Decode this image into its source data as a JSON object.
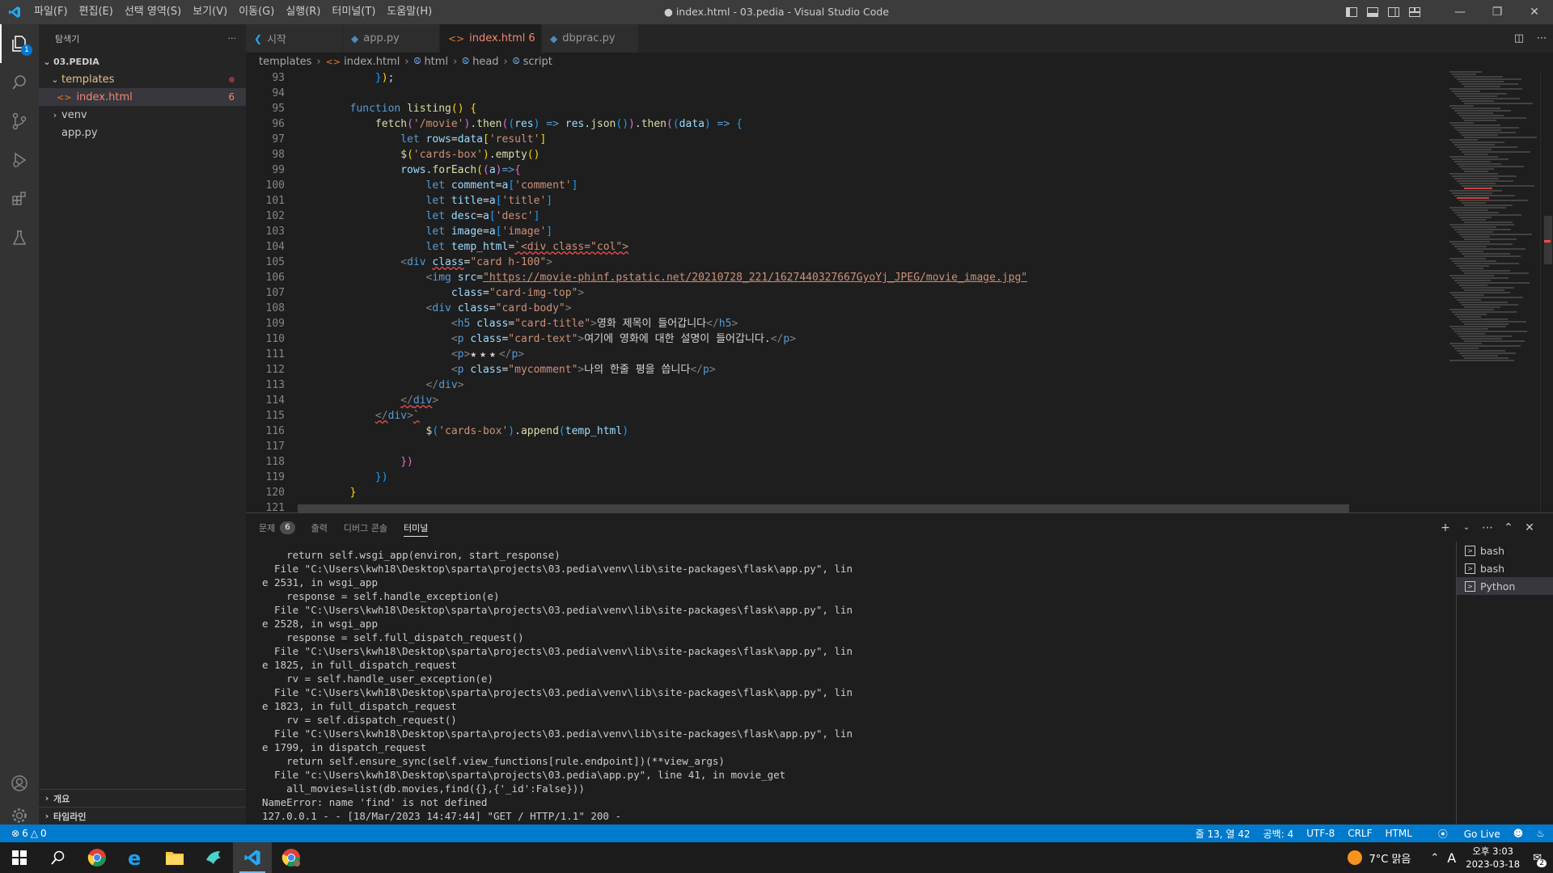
{
  "window": {
    "title": "● index.html - 03.pedia - Visual Studio Code"
  },
  "menu": [
    "파일(F)",
    "편집(E)",
    "선택 영역(S)",
    "보기(V)",
    "이동(G)",
    "실행(R)",
    "터미널(T)",
    "도움말(H)"
  ],
  "activity": {
    "explorer_badge": "1"
  },
  "sidebar": {
    "title": "탐색기",
    "more": "···",
    "root": "03.PEDIA",
    "templates": "templates",
    "index_file": "index.html",
    "index_count": "6",
    "venv": "venv",
    "app": "app.py",
    "outline": "개요",
    "timeline": "타임라인"
  },
  "tabs": [
    {
      "label": "시작",
      "icon": "vscode-icon"
    },
    {
      "label": "app.py",
      "icon": "python-icon"
    },
    {
      "label": "index.html",
      "count": "6",
      "icon": "html-icon"
    },
    {
      "label": "dbprac.py",
      "icon": "python-icon"
    }
  ],
  "breadcrumb": [
    "templates",
    "index.html",
    "html",
    "head",
    "script"
  ],
  "editor": {
    "line_numbers": [
      "93",
      "94",
      "95",
      "96",
      "97",
      "98",
      "99",
      "100",
      "101",
      "102",
      "103",
      "104",
      "105",
      "106",
      "107",
      "108",
      "109",
      "110",
      "111",
      "112",
      "113",
      "114",
      "115",
      "116",
      "117",
      "118",
      "119",
      "120",
      "121"
    ],
    "strings": {
      "movie_url": "'/movie'",
      "result": "'result'",
      "cards_box": "'cards-box'",
      "comment": "'comment'",
      "title": "'title'",
      "desc": "'desc'",
      "image": "'image'",
      "div_col": "`<div class=\"col\">",
      "card_h100": "\"card h-100\"",
      "img_src": "\"https://movie-phinf.pstatic.net/20210728_221/1627440327667GyoYj_JPEG/movie_image.jpg\"",
      "card_img_top": "\"card-img-top\"",
      "card_body": "\"card-body\"",
      "card_title": "\"card-title\"",
      "h5_text": "영화 제목이 들어갑니다",
      "card_text": "\"card-text\"",
      "p_text": "여기에 영화에 대한 설명이 들어갑니다.",
      "stars": "★★★",
      "mycomment": "\"mycomment\"",
      "comment_text": "나의 한줄 평을 씁니다"
    }
  },
  "panel": {
    "tabs": [
      "문제",
      "출력",
      "디버그 콘솔",
      "터미널"
    ],
    "problems_count": "6",
    "terminal_lines": [
      "    return self.wsgi_app(environ, start_response)",
      "  File \"C:\\Users\\kwh18\\Desktop\\sparta\\projects\\03.pedia\\venv\\lib\\site-packages\\flask\\app.py\", lin",
      "e 2531, in wsgi_app",
      "    response = self.handle_exception(e)",
      "  File \"C:\\Users\\kwh18\\Desktop\\sparta\\projects\\03.pedia\\venv\\lib\\site-packages\\flask\\app.py\", lin",
      "e 2528, in wsgi_app",
      "    response = self.full_dispatch_request()",
      "  File \"C:\\Users\\kwh18\\Desktop\\sparta\\projects\\03.pedia\\venv\\lib\\site-packages\\flask\\app.py\", lin",
      "e 1825, in full_dispatch_request",
      "    rv = self.handle_user_exception(e)",
      "  File \"C:\\Users\\kwh18\\Desktop\\sparta\\projects\\03.pedia\\venv\\lib\\site-packages\\flask\\app.py\", lin",
      "e 1823, in full_dispatch_request",
      "    rv = self.dispatch_request()",
      "  File \"C:\\Users\\kwh18\\Desktop\\sparta\\projects\\03.pedia\\venv\\lib\\site-packages\\flask\\app.py\", lin",
      "e 1799, in dispatch_request",
      "    return self.ensure_sync(self.view_functions[rule.endpoint])(**view_args)",
      "  File \"c:\\Users\\kwh18\\Desktop\\sparta\\projects\\03.pedia\\app.py\", line 41, in movie_get",
      "    all_movies=list(db.movies,find({},{'_id':False}))",
      "NameError: name 'find' is not defined",
      "127.0.0.1 - - [18/Mar/2023 14:47:44] \"GET / HTTP/1.1\" 200 -"
    ],
    "terminals": [
      "bash",
      "bash",
      "Python"
    ]
  },
  "status": {
    "errors": "6",
    "warnings": "0",
    "position": "줄 13, 열 42",
    "spaces": "공백: 4",
    "encoding": "UTF-8",
    "eol": "CRLF",
    "language": "HTML",
    "golive": "Go Live"
  },
  "taskbar": {
    "weather": "7°C 맑음",
    "ime": "A",
    "time": "오후 3:03",
    "date": "2023-03-18",
    "notifications": "2"
  },
  "colors": {
    "accent": "#007acc",
    "titlebar": "#3c3c3c",
    "editor_bg": "#1e1e1e",
    "error": "#f14c4c"
  }
}
